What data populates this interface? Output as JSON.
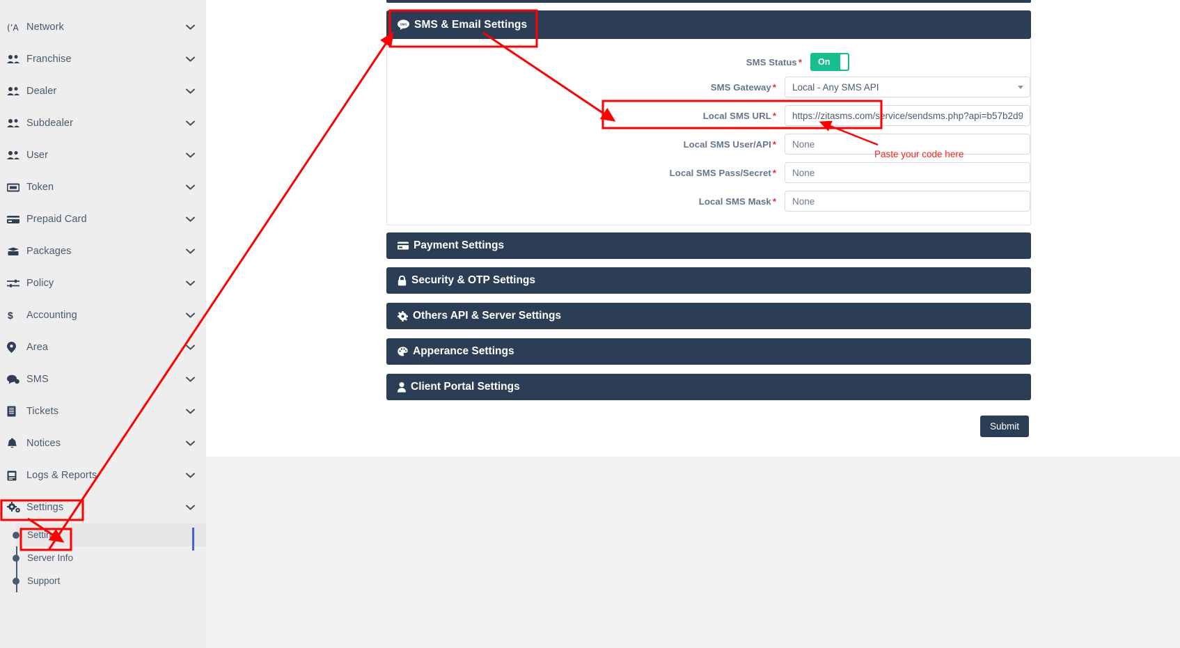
{
  "sidebar": {
    "items": [
      {
        "label": "Network",
        "icon": "antenna-icon",
        "has_chevron": true
      },
      {
        "label": "Franchise",
        "icon": "users-icon",
        "has_chevron": true
      },
      {
        "label": "Dealer",
        "icon": "users-icon",
        "has_chevron": true
      },
      {
        "label": "Subdealer",
        "icon": "users-icon",
        "has_chevron": true
      },
      {
        "label": "User",
        "icon": "users-icon",
        "has_chevron": true
      },
      {
        "label": "Token",
        "icon": "ticket-icon",
        "has_chevron": true
      },
      {
        "label": "Prepaid Card",
        "icon": "credit-card-icon",
        "has_chevron": true
      },
      {
        "label": "Packages",
        "icon": "box-icon",
        "has_chevron": true
      },
      {
        "label": "Policy",
        "icon": "sliders-icon",
        "has_chevron": true
      },
      {
        "label": "Accounting",
        "icon": "dollar-icon",
        "has_chevron": true
      },
      {
        "label": "Area",
        "icon": "map-pin-icon",
        "has_chevron": true
      },
      {
        "label": "SMS",
        "icon": "comments-icon",
        "has_chevron": true
      },
      {
        "label": "Tickets",
        "icon": "receipt-icon",
        "has_chevron": true
      },
      {
        "label": "Notices",
        "icon": "bell-icon",
        "has_chevron": true
      },
      {
        "label": "Logs & Reports",
        "icon": "book-icon",
        "has_chevron": true
      },
      {
        "label": "Settings",
        "icon": "gears-icon",
        "has_chevron": true
      }
    ],
    "submenu": [
      {
        "label": "Settings"
      },
      {
        "label": "Server Info"
      },
      {
        "label": "Support"
      }
    ]
  },
  "accordion": {
    "open": {
      "title": "SMS & Email Settings",
      "icon": "sms-bubble-icon"
    },
    "collapsed": [
      {
        "title": "Payment Settings",
        "icon": "credit-card-icon"
      },
      {
        "title": "Security & OTP Settings",
        "icon": "lock-icon"
      },
      {
        "title": "Others API & Server Settings",
        "icon": "gear-icon"
      },
      {
        "title": "Apperance Settings",
        "icon": "palette-icon"
      },
      {
        "title": "Client Portal Settings",
        "icon": "user-icon"
      }
    ]
  },
  "form": {
    "required_mark": "*",
    "fields": [
      {
        "label": "SMS Status",
        "type": "toggle",
        "value": "On"
      },
      {
        "label": "SMS Gateway",
        "type": "select",
        "value": "Local - Any SMS API"
      },
      {
        "label": "Local SMS URL",
        "type": "text",
        "value": "https://zitasms.com/service/sendsms.php?api=b57b2d9",
        "placeholder": ""
      },
      {
        "label": "Local SMS User/API",
        "type": "text",
        "value": "",
        "placeholder": "None"
      },
      {
        "label": "Local SMS Pass/Secret",
        "type": "text",
        "value": "",
        "placeholder": "None"
      },
      {
        "label": "Local SMS Mask",
        "type": "text",
        "value": "",
        "placeholder": "None"
      }
    ],
    "submit_label": "Submit"
  },
  "annotations": {
    "paste_hint": "Paste your code here",
    "color": "#ff0000"
  }
}
